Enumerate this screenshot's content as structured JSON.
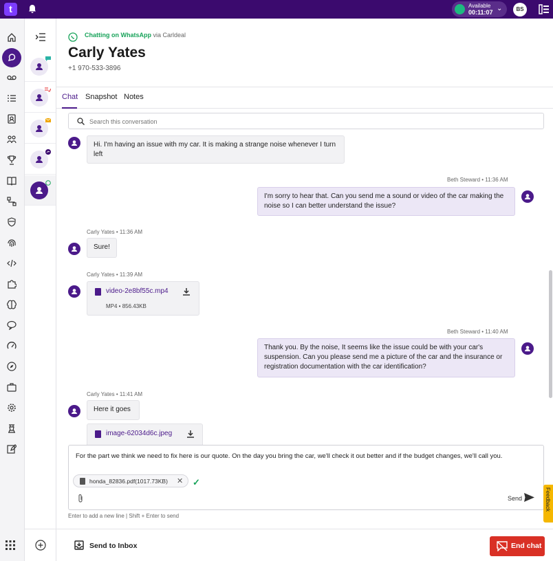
{
  "topbar": {
    "logo": "t",
    "status_label": "Available",
    "status_timer": "00:11:07",
    "user_initials": "BS",
    "colors": {
      "bar": "#3b0a6e",
      "available": "#1eb980"
    }
  },
  "rail_icons": [
    "home-icon",
    "chat-icon",
    "voicemail-icon",
    "list-icon",
    "contacts-icon",
    "teams-icon",
    "trophy-icon",
    "book-icon",
    "flow-icon",
    "shield-icon",
    "fingerprint-icon",
    "code-icon",
    "puzzle-icon",
    "brain-icon",
    "speech-icon",
    "gauge-icon",
    "compass-icon",
    "briefcase-icon",
    "gear-icon",
    "chess-icon",
    "edit-icon"
  ],
  "conversation_list": {
    "items": [
      {
        "badge": "chat-badge-icon",
        "selected": false
      },
      {
        "badge": "sms-badge-icon",
        "selected": false
      },
      {
        "badge": "email-badge-icon",
        "selected": false
      },
      {
        "badge": "messenger-badge-icon",
        "selected": false
      },
      {
        "badge": "whatsapp-badge-icon",
        "selected": true
      }
    ]
  },
  "header": {
    "channel": "Chatting on WhatsApp",
    "via": "via Carldeal",
    "contact_name": "Carly Yates",
    "phone": "+1 970-533-3896"
  },
  "tabs": [
    {
      "label": "Chat",
      "active": true
    },
    {
      "label": "Snapshot",
      "active": false
    },
    {
      "label": "Notes",
      "active": false
    }
  ],
  "search": {
    "placeholder": "Search this conversation"
  },
  "messages": {
    "m1": {
      "text": "Hi. I'm having an issue with my car. It is making a strange noise whenever I turn left"
    },
    "m2": {
      "meta": "Beth Steward • 11:36 AM",
      "text": "I'm sorry to hear that. Can you send me a sound or video of the car making the noise so I can better understand the issue?"
    },
    "m3": {
      "meta": "Carly Yates • 11:36 AM",
      "text": "Sure!"
    },
    "m4": {
      "meta": "Carly Yates • 11:39 AM",
      "file": "video-2e8bf55c.mp4",
      "size": "MP4 • 856.43KB"
    },
    "m5": {
      "meta": "Beth Steward • 11:40 AM",
      "text": "Thank you. By the noise, It seems like the issue could be with your car's suspension. Can you please send me a picture of the car and the insurance or registration documentation with the car identification?"
    },
    "m6": {
      "meta": "Carly Yates • 11:41 AM",
      "text": "Here it goes"
    },
    "m7": {
      "file": "image-62034d6c.jpeg"
    }
  },
  "composer": {
    "text": "For the part we think we need to fix here is our quote. On the day you bring the car, we'll check it out better and if the budget changes, we'll call you.",
    "attachment": "honda_82836.pdf(1017.73KB)",
    "send_label": "Send",
    "hint": "Enter to add a new line | Shift + Enter to send"
  },
  "footer": {
    "send_to_inbox": "Send to Inbox",
    "end_chat": "End chat",
    "end_color": "#d93025"
  },
  "feedback_label": "Feedback"
}
